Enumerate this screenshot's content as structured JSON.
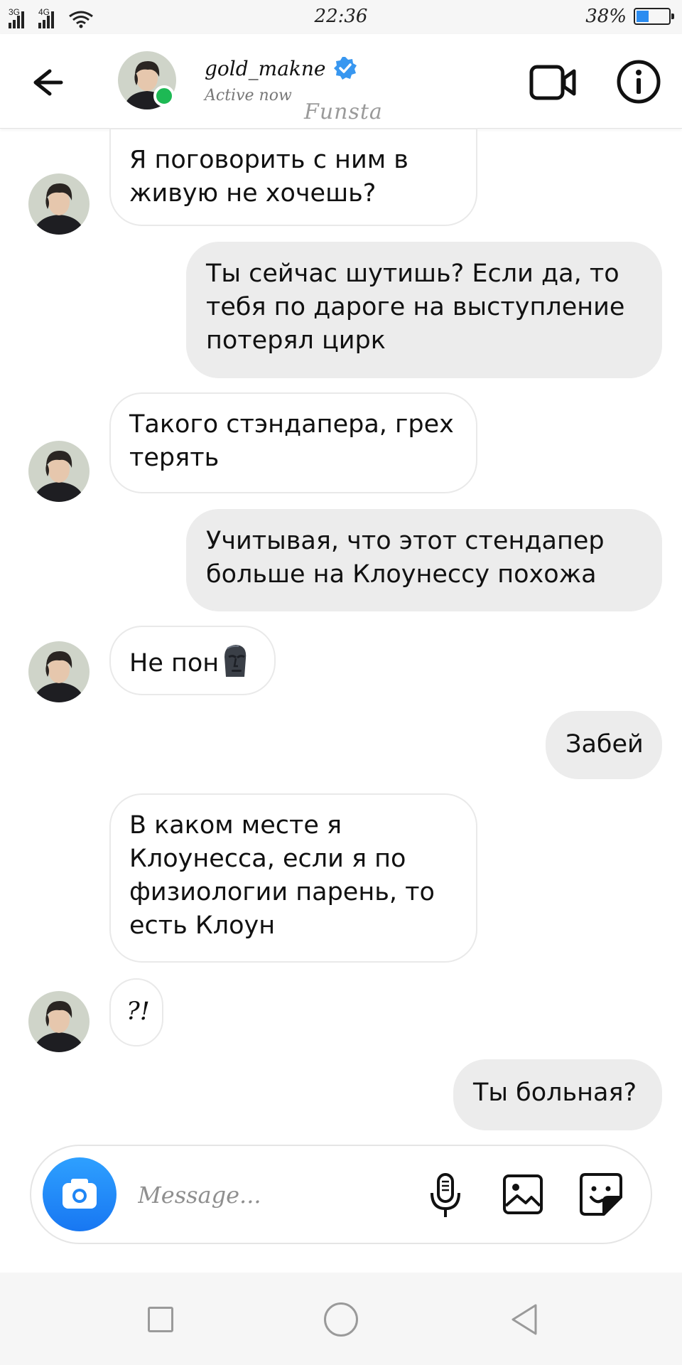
{
  "status_bar": {
    "network_1": "3G",
    "network_2": "4G",
    "time": "22:36",
    "battery_percent_label": "38%",
    "battery_level": 0.38,
    "icons": [
      "signal-icon",
      "wifi-icon",
      "battery-icon"
    ]
  },
  "header": {
    "username": "gold_makne",
    "status": "Active now",
    "watermark": "Funsta",
    "verified": true,
    "icons": [
      "back-arrow-icon",
      "verified-badge-icon",
      "video-call-icon",
      "info-icon"
    ]
  },
  "messages": [
    {
      "sender": "them",
      "text": "Я поговорить с ним в живую не хочешь?",
      "lines": [
        "Я поговорить с ним в",
        "живую не хочешь?"
      ]
    },
    {
      "sender": "me",
      "text": "Ты сейчас шутишь? Если да, то тебя по дароге на выступление потерял цирк",
      "lines": [
        "Ты сейчас шутишь? Если да, то",
        "тебя по дароге на выступление",
        "потерял цирк"
      ]
    },
    {
      "sender": "them",
      "text": "Такого стэндапера, грех терять",
      "lines": [
        "Такого стэндапера, грех",
        "терять"
      ]
    },
    {
      "sender": "me",
      "text": "Учитывая, что этот стендапер больше на Клоунессу похожа",
      "lines": [
        "Учитывая, что этот стендапер",
        "больше на Клоунессу похожа"
      ]
    },
    {
      "sender": "them",
      "text": "Не пон",
      "emoji": "moai-face-icon"
    },
    {
      "sender": "me",
      "text": "Забей"
    },
    {
      "sender": "them",
      "text": "В каком месте я Клоунесса, если я по физиологии парень, то есть Клоун",
      "lines": [
        "В каком месте я",
        "Клоунесса, если я по",
        "физиологии парень, то",
        "есть Клоун"
      ]
    },
    {
      "sender": "them",
      "text": "?!"
    },
    {
      "sender": "me",
      "text": "Ты больная?"
    }
  ],
  "composer": {
    "placeholder": "Message...",
    "icons": [
      "camera-icon",
      "microphone-icon",
      "gallery-icon",
      "sticker-icon"
    ]
  },
  "nav_bar": {
    "icons": [
      "recent-apps-icon",
      "home-icon",
      "back-icon"
    ]
  },
  "colors": {
    "accent_blue": "#1877f2",
    "online_green": "#1db954",
    "incoming_bubble": "#ffffff",
    "outgoing_bubble": "#ececec"
  }
}
